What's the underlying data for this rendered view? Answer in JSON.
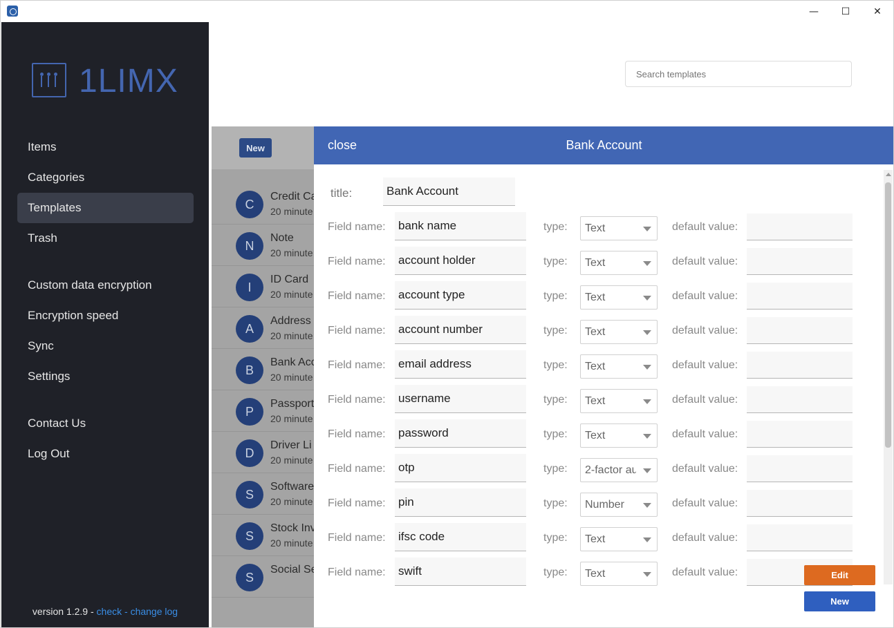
{
  "window": {
    "minimize_glyph": "—",
    "maximize_glyph": "☐",
    "close_glyph": "✕"
  },
  "sidebar": {
    "logo_text": "1LIMX",
    "nav_group1": [
      {
        "label": "Items",
        "active": false
      },
      {
        "label": "Categories",
        "active": false
      },
      {
        "label": "Templates",
        "active": true
      },
      {
        "label": "Trash",
        "active": false
      }
    ],
    "nav_group2": [
      {
        "label": "Custom data encryption"
      },
      {
        "label": "Encryption speed"
      },
      {
        "label": "Sync"
      },
      {
        "label": "Settings"
      }
    ],
    "nav_group3": [
      {
        "label": "Contact Us"
      },
      {
        "label": "Log Out"
      }
    ],
    "version_text": "version 1.2.9 - ",
    "check_link": "check",
    "separator": " - ",
    "changelog_link": "change log"
  },
  "search": {
    "placeholder": "Search templates"
  },
  "list": {
    "new_button": "New",
    "items": [
      {
        "letter": "C",
        "title": "Credit Ca",
        "subtitle": "20 minute"
      },
      {
        "letter": "N",
        "title": "Note",
        "subtitle": "20 minute"
      },
      {
        "letter": "I",
        "title": "ID Card",
        "subtitle": "20 minute"
      },
      {
        "letter": "A",
        "title": "Address",
        "subtitle": "20 minute"
      },
      {
        "letter": "B",
        "title": "Bank Acc",
        "subtitle": "20 minute"
      },
      {
        "letter": "P",
        "title": "Passport",
        "subtitle": "20 minute"
      },
      {
        "letter": "D",
        "title": "Driver Li",
        "subtitle": "20 minute"
      },
      {
        "letter": "S",
        "title": "Software",
        "subtitle": "20 minute"
      },
      {
        "letter": "S",
        "title": "Stock Inv",
        "subtitle": "20 minute"
      },
      {
        "letter": "S",
        "title": "Social Se",
        "subtitle": ""
      }
    ]
  },
  "modal": {
    "close_label": "close",
    "heading": "Bank Account",
    "title_label": "title:",
    "title_value": "Bank Account",
    "field_label": "Field name:",
    "type_label": "type:",
    "default_label": "default value:",
    "fields": [
      {
        "name": "bank name",
        "type": "Text",
        "default": ""
      },
      {
        "name": "account holder",
        "type": "Text",
        "default": ""
      },
      {
        "name": "account type",
        "type": "Text",
        "default": ""
      },
      {
        "name": "account number",
        "type": "Text",
        "default": ""
      },
      {
        "name": "email address",
        "type": "Text",
        "default": ""
      },
      {
        "name": "username",
        "type": "Text",
        "default": ""
      },
      {
        "name": "password",
        "type": "Text",
        "default": ""
      },
      {
        "name": "otp",
        "type": "2-factor au",
        "default": ""
      },
      {
        "name": "pin",
        "type": "Number",
        "default": ""
      },
      {
        "name": "ifsc code",
        "type": "Text",
        "default": ""
      },
      {
        "name": "swift",
        "type": "Text",
        "default": ""
      }
    ],
    "edit_button": "Edit",
    "new_button": "New"
  }
}
